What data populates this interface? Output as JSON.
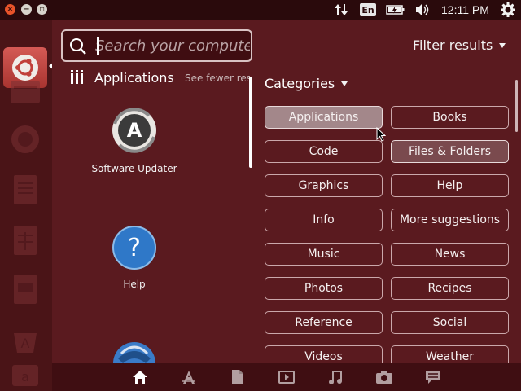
{
  "top_panel": {
    "lang": "En",
    "clock": "12:11 PM"
  },
  "search": {
    "placeholder": "Search your compute"
  },
  "filter": {
    "label": "Filter results"
  },
  "applications": {
    "title": "Applications",
    "see_fewer": "See fewer res",
    "items": [
      {
        "label": "Software Updater",
        "icon": "software-updater-icon"
      },
      {
        "label": "Help",
        "icon": "help-icon"
      },
      {
        "label": "",
        "icon": "thunderbird-icon"
      }
    ]
  },
  "categories": {
    "title": "Categories",
    "items": [
      "Applications",
      "Books",
      "Code",
      "Files & Folders",
      "Graphics",
      "Help",
      "Info",
      "More suggestions",
      "Music",
      "News",
      "Photos",
      "Recipes",
      "Reference",
      "Social",
      "Videos",
      "Weather"
    ],
    "active": [
      "Applications",
      "Files & Folders"
    ]
  },
  "lenses": [
    "home-icon",
    "applications-icon",
    "files-icon",
    "video-icon",
    "music-icon",
    "photo-icon",
    "social-icon"
  ],
  "colors": {
    "accent": "#a3878a",
    "background": "#5a1a1f",
    "panel": "#2a0a0c"
  }
}
